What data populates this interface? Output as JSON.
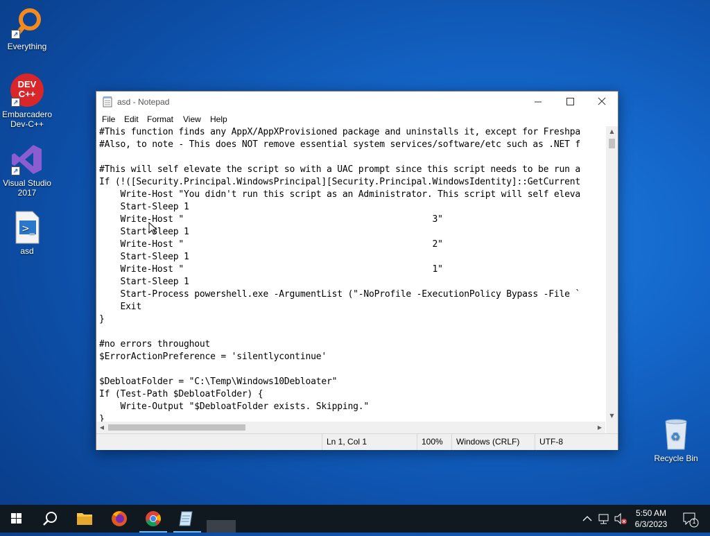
{
  "desktop": {
    "icons": [
      {
        "label": "Everything"
      },
      {
        "label": "Embarcadero Dev-C++",
        "line1": "Embarcadero",
        "line2": "Dev-C++",
        "badge": "DEV C++"
      },
      {
        "label": "Visual Studio 2017",
        "line1": "Visual Studio",
        "line2": "2017"
      },
      {
        "label": "asd"
      },
      {
        "label": "Recycle Bin"
      }
    ]
  },
  "notepad": {
    "title": "asd - Notepad",
    "menu": [
      "File",
      "Edit",
      "Format",
      "View",
      "Help"
    ],
    "content": "#This function finds any AppX/AppXProvisioned package and uninstalls it, except for Freshpa\n#Also, to note - This does NOT remove essential system services/software/etc such as .NET f\n\n#This will self elevate the script so with a UAC prompt since this script needs to be run a\nIf (!([Security.Principal.WindowsPrincipal][Security.Principal.WindowsIdentity]::GetCurrent\n    Write-Host \"You didn't run this script as an Administrator. This script will self eleva\n    Start-Sleep 1\n    Write-Host \"                                               3\"\n    Start-Sleep 1\n    Write-Host \"                                               2\"\n    Start-Sleep 1\n    Write-Host \"                                               1\"\n    Start-Sleep 1\n    Start-Process powershell.exe -ArgumentList (\"-NoProfile -ExecutionPolicy Bypass -File `\n    Exit\n}\n\n#no errors throughout\n$ErrorActionPreference = 'silentlycontinue'\n\n$DebloatFolder = \"C:\\Temp\\Windows10Debloater\"\nIf (Test-Path $DebloatFolder) {\n    Write-Output \"$DebloatFolder exists. Skipping.\"\n}",
    "status": {
      "position": "Ln 1, Col 1",
      "zoom": "100%",
      "line_ending": "Windows (CRLF)",
      "encoding": "UTF-8"
    }
  },
  "taskbar": {
    "time": "5:50 AM",
    "date": "6/3/2023",
    "notification_count": "1",
    "apps": [
      "start",
      "search",
      "file-explorer",
      "firefox",
      "chrome",
      "notepad",
      "blank"
    ]
  },
  "colors": {
    "accent": "#0078d7",
    "taskbar": "#101820",
    "desktop": "#1466c9"
  }
}
